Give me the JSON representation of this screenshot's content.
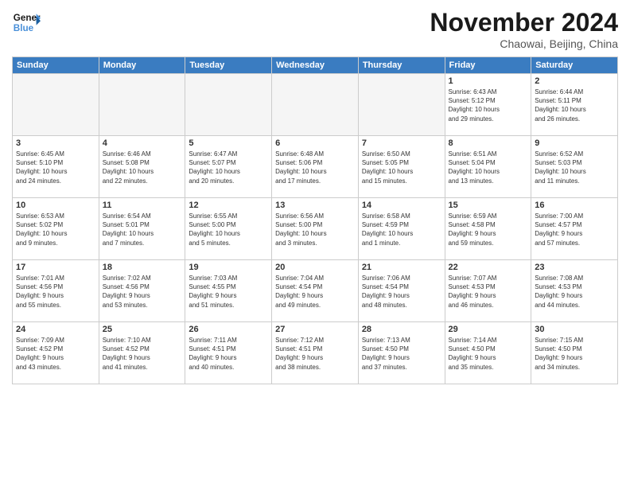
{
  "header": {
    "logo_line1": "General",
    "logo_line2": "Blue",
    "month": "November 2024",
    "location": "Chaowai, Beijing, China"
  },
  "weekdays": [
    "Sunday",
    "Monday",
    "Tuesday",
    "Wednesday",
    "Thursday",
    "Friday",
    "Saturday"
  ],
  "weeks": [
    [
      {
        "day": "",
        "info": ""
      },
      {
        "day": "",
        "info": ""
      },
      {
        "day": "",
        "info": ""
      },
      {
        "day": "",
        "info": ""
      },
      {
        "day": "",
        "info": ""
      },
      {
        "day": "1",
        "info": "Sunrise: 6:43 AM\nSunset: 5:12 PM\nDaylight: 10 hours\nand 29 minutes."
      },
      {
        "day": "2",
        "info": "Sunrise: 6:44 AM\nSunset: 5:11 PM\nDaylight: 10 hours\nand 26 minutes."
      }
    ],
    [
      {
        "day": "3",
        "info": "Sunrise: 6:45 AM\nSunset: 5:10 PM\nDaylight: 10 hours\nand 24 minutes."
      },
      {
        "day": "4",
        "info": "Sunrise: 6:46 AM\nSunset: 5:08 PM\nDaylight: 10 hours\nand 22 minutes."
      },
      {
        "day": "5",
        "info": "Sunrise: 6:47 AM\nSunset: 5:07 PM\nDaylight: 10 hours\nand 20 minutes."
      },
      {
        "day": "6",
        "info": "Sunrise: 6:48 AM\nSunset: 5:06 PM\nDaylight: 10 hours\nand 17 minutes."
      },
      {
        "day": "7",
        "info": "Sunrise: 6:50 AM\nSunset: 5:05 PM\nDaylight: 10 hours\nand 15 minutes."
      },
      {
        "day": "8",
        "info": "Sunrise: 6:51 AM\nSunset: 5:04 PM\nDaylight: 10 hours\nand 13 minutes."
      },
      {
        "day": "9",
        "info": "Sunrise: 6:52 AM\nSunset: 5:03 PM\nDaylight: 10 hours\nand 11 minutes."
      }
    ],
    [
      {
        "day": "10",
        "info": "Sunrise: 6:53 AM\nSunset: 5:02 PM\nDaylight: 10 hours\nand 9 minutes."
      },
      {
        "day": "11",
        "info": "Sunrise: 6:54 AM\nSunset: 5:01 PM\nDaylight: 10 hours\nand 7 minutes."
      },
      {
        "day": "12",
        "info": "Sunrise: 6:55 AM\nSunset: 5:00 PM\nDaylight: 10 hours\nand 5 minutes."
      },
      {
        "day": "13",
        "info": "Sunrise: 6:56 AM\nSunset: 5:00 PM\nDaylight: 10 hours\nand 3 minutes."
      },
      {
        "day": "14",
        "info": "Sunrise: 6:58 AM\nSunset: 4:59 PM\nDaylight: 10 hours\nand 1 minute."
      },
      {
        "day": "15",
        "info": "Sunrise: 6:59 AM\nSunset: 4:58 PM\nDaylight: 9 hours\nand 59 minutes."
      },
      {
        "day": "16",
        "info": "Sunrise: 7:00 AM\nSunset: 4:57 PM\nDaylight: 9 hours\nand 57 minutes."
      }
    ],
    [
      {
        "day": "17",
        "info": "Sunrise: 7:01 AM\nSunset: 4:56 PM\nDaylight: 9 hours\nand 55 minutes."
      },
      {
        "day": "18",
        "info": "Sunrise: 7:02 AM\nSunset: 4:56 PM\nDaylight: 9 hours\nand 53 minutes."
      },
      {
        "day": "19",
        "info": "Sunrise: 7:03 AM\nSunset: 4:55 PM\nDaylight: 9 hours\nand 51 minutes."
      },
      {
        "day": "20",
        "info": "Sunrise: 7:04 AM\nSunset: 4:54 PM\nDaylight: 9 hours\nand 49 minutes."
      },
      {
        "day": "21",
        "info": "Sunrise: 7:06 AM\nSunset: 4:54 PM\nDaylight: 9 hours\nand 48 minutes."
      },
      {
        "day": "22",
        "info": "Sunrise: 7:07 AM\nSunset: 4:53 PM\nDaylight: 9 hours\nand 46 minutes."
      },
      {
        "day": "23",
        "info": "Sunrise: 7:08 AM\nSunset: 4:53 PM\nDaylight: 9 hours\nand 44 minutes."
      }
    ],
    [
      {
        "day": "24",
        "info": "Sunrise: 7:09 AM\nSunset: 4:52 PM\nDaylight: 9 hours\nand 43 minutes."
      },
      {
        "day": "25",
        "info": "Sunrise: 7:10 AM\nSunset: 4:52 PM\nDaylight: 9 hours\nand 41 minutes."
      },
      {
        "day": "26",
        "info": "Sunrise: 7:11 AM\nSunset: 4:51 PM\nDaylight: 9 hours\nand 40 minutes."
      },
      {
        "day": "27",
        "info": "Sunrise: 7:12 AM\nSunset: 4:51 PM\nDaylight: 9 hours\nand 38 minutes."
      },
      {
        "day": "28",
        "info": "Sunrise: 7:13 AM\nSunset: 4:50 PM\nDaylight: 9 hours\nand 37 minutes."
      },
      {
        "day": "29",
        "info": "Sunrise: 7:14 AM\nSunset: 4:50 PM\nDaylight: 9 hours\nand 35 minutes."
      },
      {
        "day": "30",
        "info": "Sunrise: 7:15 AM\nSunset: 4:50 PM\nDaylight: 9 hours\nand 34 minutes."
      }
    ]
  ]
}
